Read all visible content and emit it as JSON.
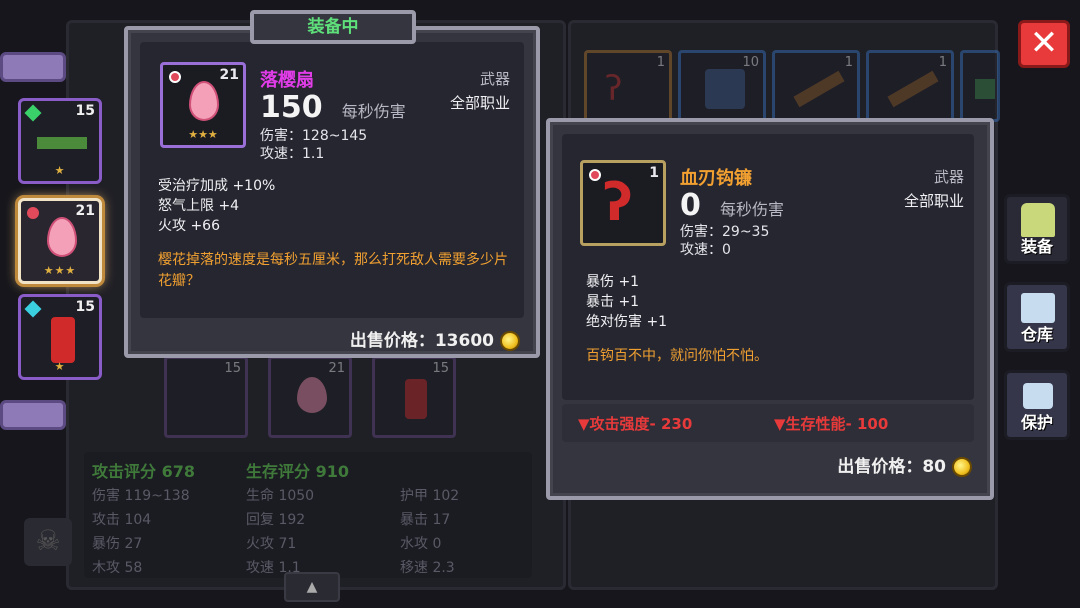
{
  "header_tab": "装备中",
  "inventory": {
    "slots": [
      {
        "count": "15",
        "stars": "★"
      },
      {
        "count": "21",
        "stars": "★★★"
      },
      {
        "count": "15",
        "stars": "★"
      }
    ],
    "top_counts": [
      "1",
      "10",
      "1",
      "1",
      ""
    ],
    "mid_counts": [
      "15",
      "21",
      "15"
    ]
  },
  "equipped": {
    "name": "落樱扇",
    "count": "21",
    "type": "武器",
    "class": "全部职业",
    "dps_value": "150",
    "dps_label": "每秒伤害",
    "damage": "伤害：128~145",
    "speed": "攻速：1.1",
    "affixes": [
      "受治疗加成 +10%",
      "怒气上限 +4",
      "火攻 +66"
    ],
    "flavor": "樱花掉落的速度是每秒五厘米，那么打死敌人需要多少片花瓣？",
    "sell_label": "出售价格：13600"
  },
  "compare": {
    "name": "血刃钩镰",
    "count": "1",
    "type": "武器",
    "class": "全部职业",
    "dps_value": "0",
    "dps_label": "每秒伤害",
    "damage": "伤害：29~35",
    "speed": "攻速：0",
    "affixes": [
      "暴伤 +1",
      "暴击 +1",
      "绝对伤害 +1"
    ],
    "flavor": "百钩百不中，就问你怕不怕。",
    "diff_attack": "▼攻击强度- 230",
    "diff_survive": "▼生存性能- 100",
    "sell_label": "出售价格：80"
  },
  "stats": {
    "attack_score": "攻击评分 678",
    "survive_score": "生存评分 910",
    "col1": [
      "伤害 119~138",
      "攻击 104",
      "暴伤 27",
      "木攻 58"
    ],
    "col2": [
      "生命 1050",
      "回复 192",
      "火攻 71",
      "攻速 1.1"
    ],
    "col3": [
      "护甲 102",
      "暴击 17",
      "水攻 0",
      "移速 2.3"
    ]
  },
  "side_buttons": {
    "equip": "装备",
    "storage": "仓库",
    "protect": "保护"
  },
  "close_label": "✕",
  "colors": {
    "rarity_pink": "#e03ce8",
    "rarity_orange": "#f2a030",
    "diff_red": "#e83a3a"
  }
}
